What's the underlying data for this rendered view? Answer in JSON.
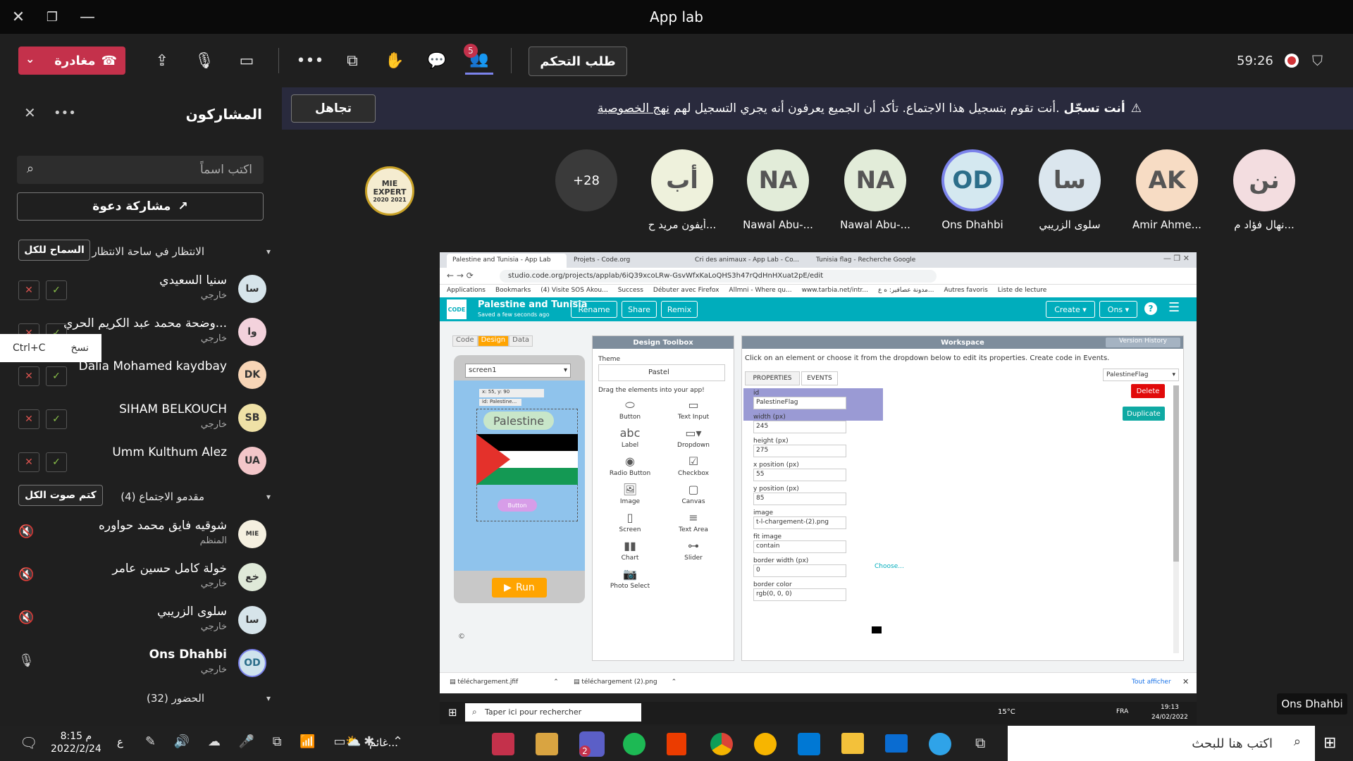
{
  "window": {
    "title": "App lab"
  },
  "toolbar": {
    "leave_label": "مغادرة",
    "take_control_label": "طلب التحكم",
    "participants_badge": "5",
    "timer": "59:26"
  },
  "banner": {
    "bold": "أنت تسجّل",
    "text": "أنت تقوم بتسجيل هذا الاجتماع. تأكد أن الجميع يعرفون أنه يجري التسجيل لهم.",
    "link": "نهج الخصوصية",
    "ignore_label": "تجاهل"
  },
  "panel": {
    "title": "المشاركون",
    "search_placeholder": "اكتب اسماً",
    "invite_label": "مشاركة دعوة",
    "lobby_header": "الانتظار في ساحة الانتظار (5)",
    "admit_all_label": "السماح للكل",
    "tooltip_copy": "نسخ",
    "tooltip_shortcut": "Ctrl+C",
    "lobby": [
      {
        "name": "سنيا السعيدي",
        "sub": "خارجي",
        "initials": "سا",
        "color": "#d6e4ea"
      },
      {
        "name": "وضحة محمد عبد الكريم الحري...",
        "sub": "خارجي",
        "initials": "وا",
        "color": "#f3d2dc"
      },
      {
        "name": "Dalia Mohamed kaydbay",
        "sub": "",
        "initials": "DK",
        "color": "#f7d5b6"
      },
      {
        "name": "SIHAM BELKOUCH",
        "sub": "خارجي",
        "initials": "SB",
        "color": "#efe1a6"
      },
      {
        "name": "Umm Kulthum Alez",
        "sub": "",
        "initials": "UA",
        "color": "#f3c6c9"
      }
    ],
    "presenters_header": "مقدمو الاجتماع (4)",
    "mute_all_label": "كتم صوت الكل",
    "presenters": [
      {
        "name": "شوقيه فايق محمد حواوره",
        "sub": "المنظم",
        "initials": "MIE",
        "color": "#f5f0e0"
      },
      {
        "name": "خولة كامل حسين عامر",
        "sub": "خارجي",
        "initials": "خع",
        "color": "#dfe9d8"
      },
      {
        "name": "سلوى الزريبي",
        "sub": "خارجي",
        "initials": "سا",
        "color": "#d6e4ea"
      },
      {
        "name": "Ons Dhahbi",
        "sub": "خارجي",
        "initials": "OD",
        "color": "#cfe3ec"
      }
    ],
    "attendees_header": "الحضور (32)"
  },
  "strip": {
    "more": "+28",
    "avatars": [
      {
        "initials": "نن",
        "name": "نهال فؤاد م...",
        "color": "#f3dde0"
      },
      {
        "initials": "AK",
        "name": "Amir Ahme...",
        "color": "#f7dcc4"
      },
      {
        "initials": "سا",
        "name": "سلوى الزريبي",
        "color": "#dbe6ee"
      },
      {
        "initials": "OD",
        "name": "Ons Dhahbi",
        "color": "#d4e8f0"
      },
      {
        "initials": "NA",
        "name": "Nawal Abu-...",
        "color": "#e2ecd9"
      },
      {
        "initials": "NA",
        "name": "Nawal Abu-...",
        "color": "#e2ecd9"
      },
      {
        "initials": "أب",
        "name": "أيفون مريد ح...",
        "color": "#eef1dc"
      }
    ],
    "mie_badge": "MIE EXPERT",
    "mie_years": "2020 2021"
  },
  "shared": {
    "tabs": [
      "Palestine and Tunisia - App Lab",
      "Projets - Code.org",
      "Cri des animaux - App Lab - Co...",
      "Tunisia flag - Recherche Google"
    ],
    "url": "studio.code.org/projects/applab/6iQ39xcoLRw-GsvWfxKaLoQHS3h47rQdHnHXuat2pE/edit",
    "bookmarks": [
      "Applications",
      "Bookmarks",
      "(4) Visite SOS Akou...",
      "Success",
      "Débuter avec Firefox",
      "Allmni - Where qu...",
      "www.tarbia.net/intr...",
      "مدونة عصافير: ه ع...",
      "Autres favoris",
      "Liste de lecture"
    ],
    "project_title": "Palestine and Tunisia",
    "saved": "Saved a few seconds ago",
    "rename": "Rename",
    "share": "Share",
    "remix": "Remix",
    "create": "Create",
    "user": "Ons",
    "tabs_left": [
      "Code",
      "Design",
      "Data"
    ],
    "screen_select": "screen1",
    "coords": "x: 55, y: 90",
    "id_hint": "id: Palestine...",
    "palestine_label": "Palestine",
    "button_label": "Button",
    "run": "Run",
    "toolbox_title": "Design Toolbox",
    "theme_label": "Theme",
    "theme_value": "Pastel",
    "drag_hint": "Drag the elements into your app!",
    "elements": [
      "Button",
      "Text Input",
      "Label",
      "Dropdown",
      "Radio Button",
      "Checkbox",
      "Image",
      "Canvas",
      "Screen",
      "Text Area",
      "Chart",
      "Slider",
      "Photo Select"
    ],
    "workspace": "Workspace",
    "version_history": "Version History",
    "ws_hint": "Click on an element or choose it from the dropdown below to edit its properties. Create code in Events.",
    "properties_tab": "PROPERTIES",
    "events_tab": "EVENTS",
    "element_select": "PalestineFlag",
    "delete": "Delete",
    "duplicate": "Duplicate",
    "props": [
      {
        "label": "id",
        "value": "PalestineFlag"
      },
      {
        "label": "width (px)",
        "value": "245"
      },
      {
        "label": "height (px)",
        "value": "275"
      },
      {
        "label": "x position (px)",
        "value": "55"
      },
      {
        "label": "y position (px)",
        "value": "85"
      },
      {
        "label": "image",
        "value": "t-l-chargement-(2).png"
      },
      {
        "label": "fit image",
        "value": "contain"
      },
      {
        "label": "border width (px)",
        "value": "0"
      },
      {
        "label": "border color",
        "value": "rgb(0, 0, 0)"
      }
    ],
    "choose": "Choose...",
    "downloads": [
      "téléchargement.jfif",
      "téléchargement (2).png"
    ],
    "show_all": "Tout afficher",
    "taskbar_search": "Taper ici pour rechercher",
    "temp": "15°C",
    "lang": "FRA",
    "time": "19:13",
    "date": "24/02/2022"
  },
  "sharer_name": "Ons Dhahbi",
  "taskbar": {
    "time": "8:15 م",
    "date": "2022/2/24",
    "lang": "ع",
    "weather": "غائم...",
    "search": "اكتب هنا للبحث",
    "teams_badge": "2"
  }
}
